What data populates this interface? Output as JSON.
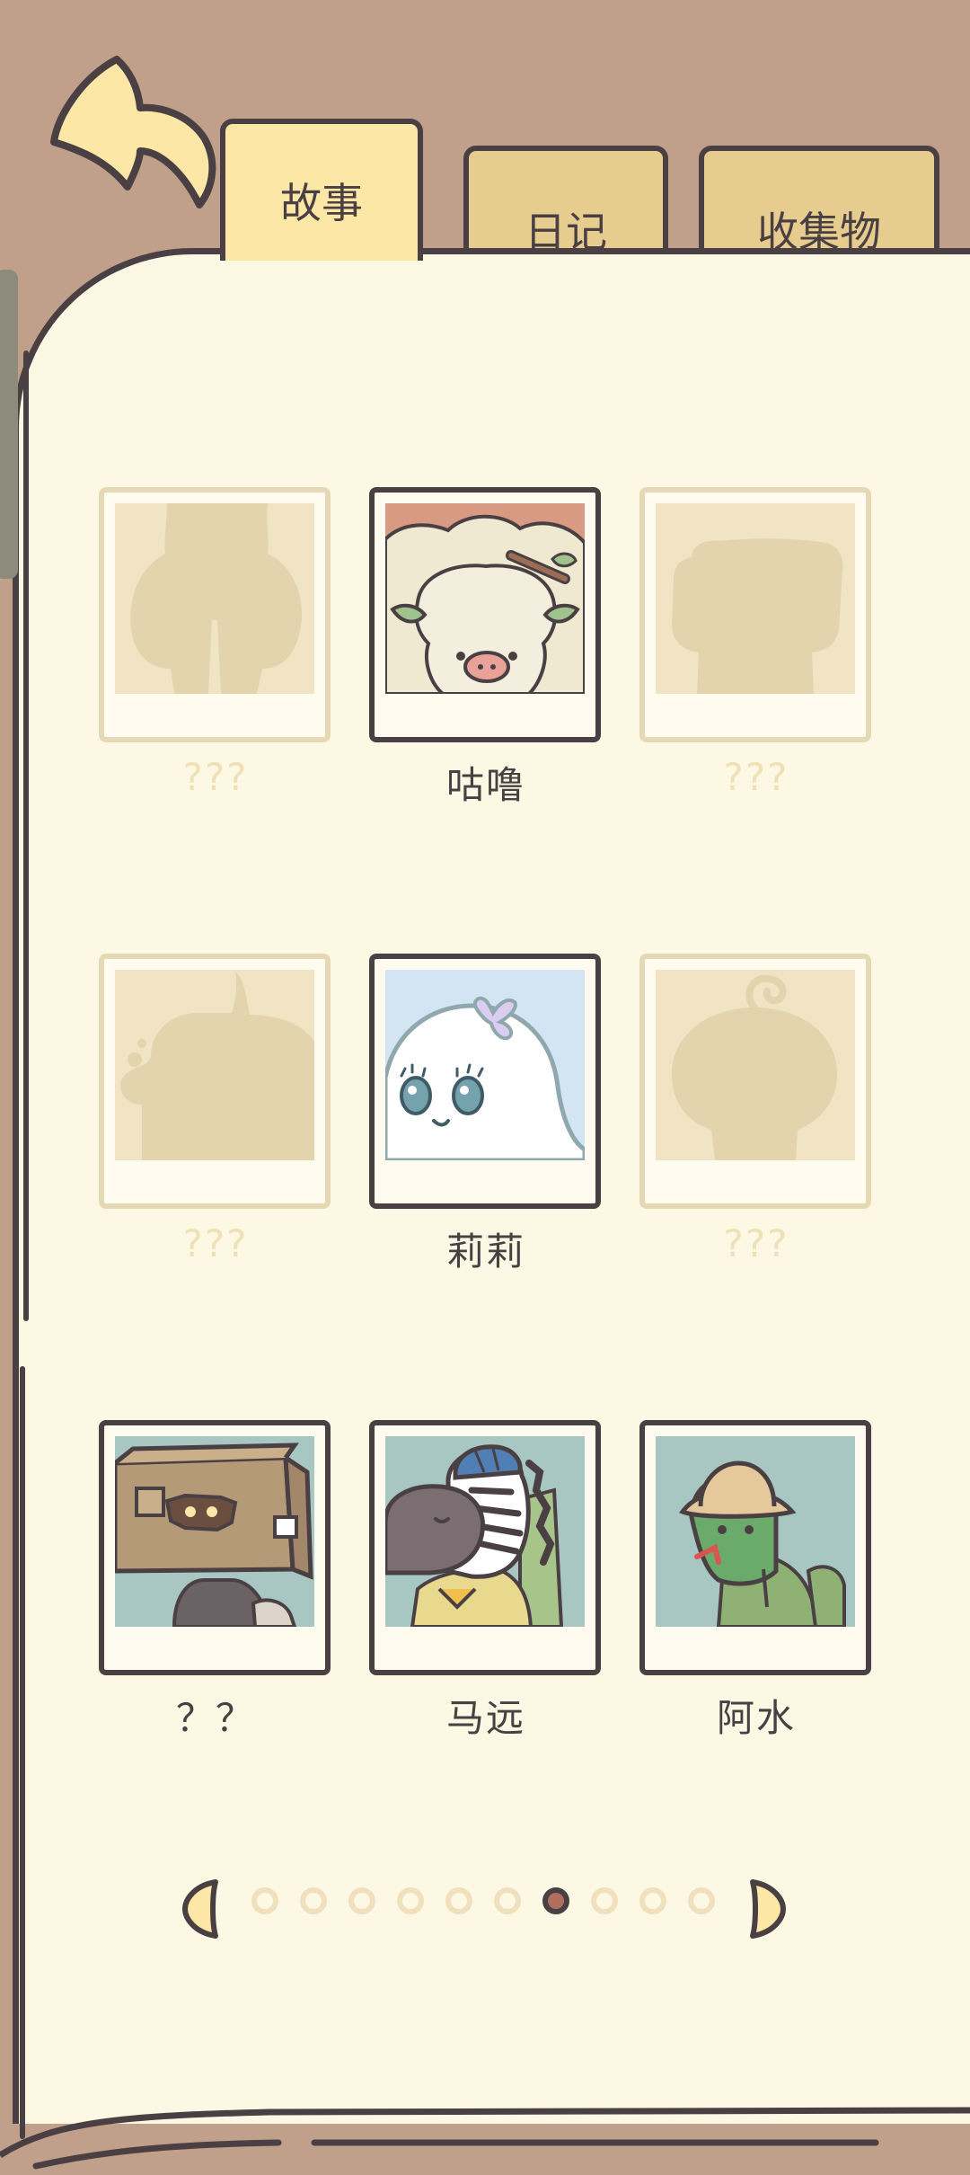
{
  "tabs": {
    "story": "故事",
    "diary": "日记",
    "collection": "收集物"
  },
  "characters": [
    {
      "name": "???",
      "unlocked": false,
      "icon": "silhouette-tall"
    },
    {
      "name": "咕噜",
      "unlocked": true,
      "icon": "sheep-portrait"
    },
    {
      "name": "???",
      "unlocked": false,
      "icon": "silhouette-square"
    },
    {
      "name": "???",
      "unlocked": false,
      "icon": "silhouette-cat"
    },
    {
      "name": "莉莉",
      "unlocked": true,
      "icon": "ghost-portrait"
    },
    {
      "name": "???",
      "unlocked": false,
      "icon": "silhouette-round"
    },
    {
      "name": "？？",
      "unlocked": true,
      "icon": "box-head-portrait"
    },
    {
      "name": "马远",
      "unlocked": true,
      "icon": "zebra-portrait"
    },
    {
      "name": "阿水",
      "unlocked": true,
      "icon": "frog-portrait"
    }
  ],
  "pagination": {
    "total_pages": 10,
    "current_page": 7
  },
  "colors": {
    "background": "#c0a08b",
    "page": "#fdf8e3",
    "outline": "#4a4043",
    "active_tab": "#fde7a6",
    "inactive_tab": "#e6cd8f",
    "active_dot": "#b06f5c"
  }
}
